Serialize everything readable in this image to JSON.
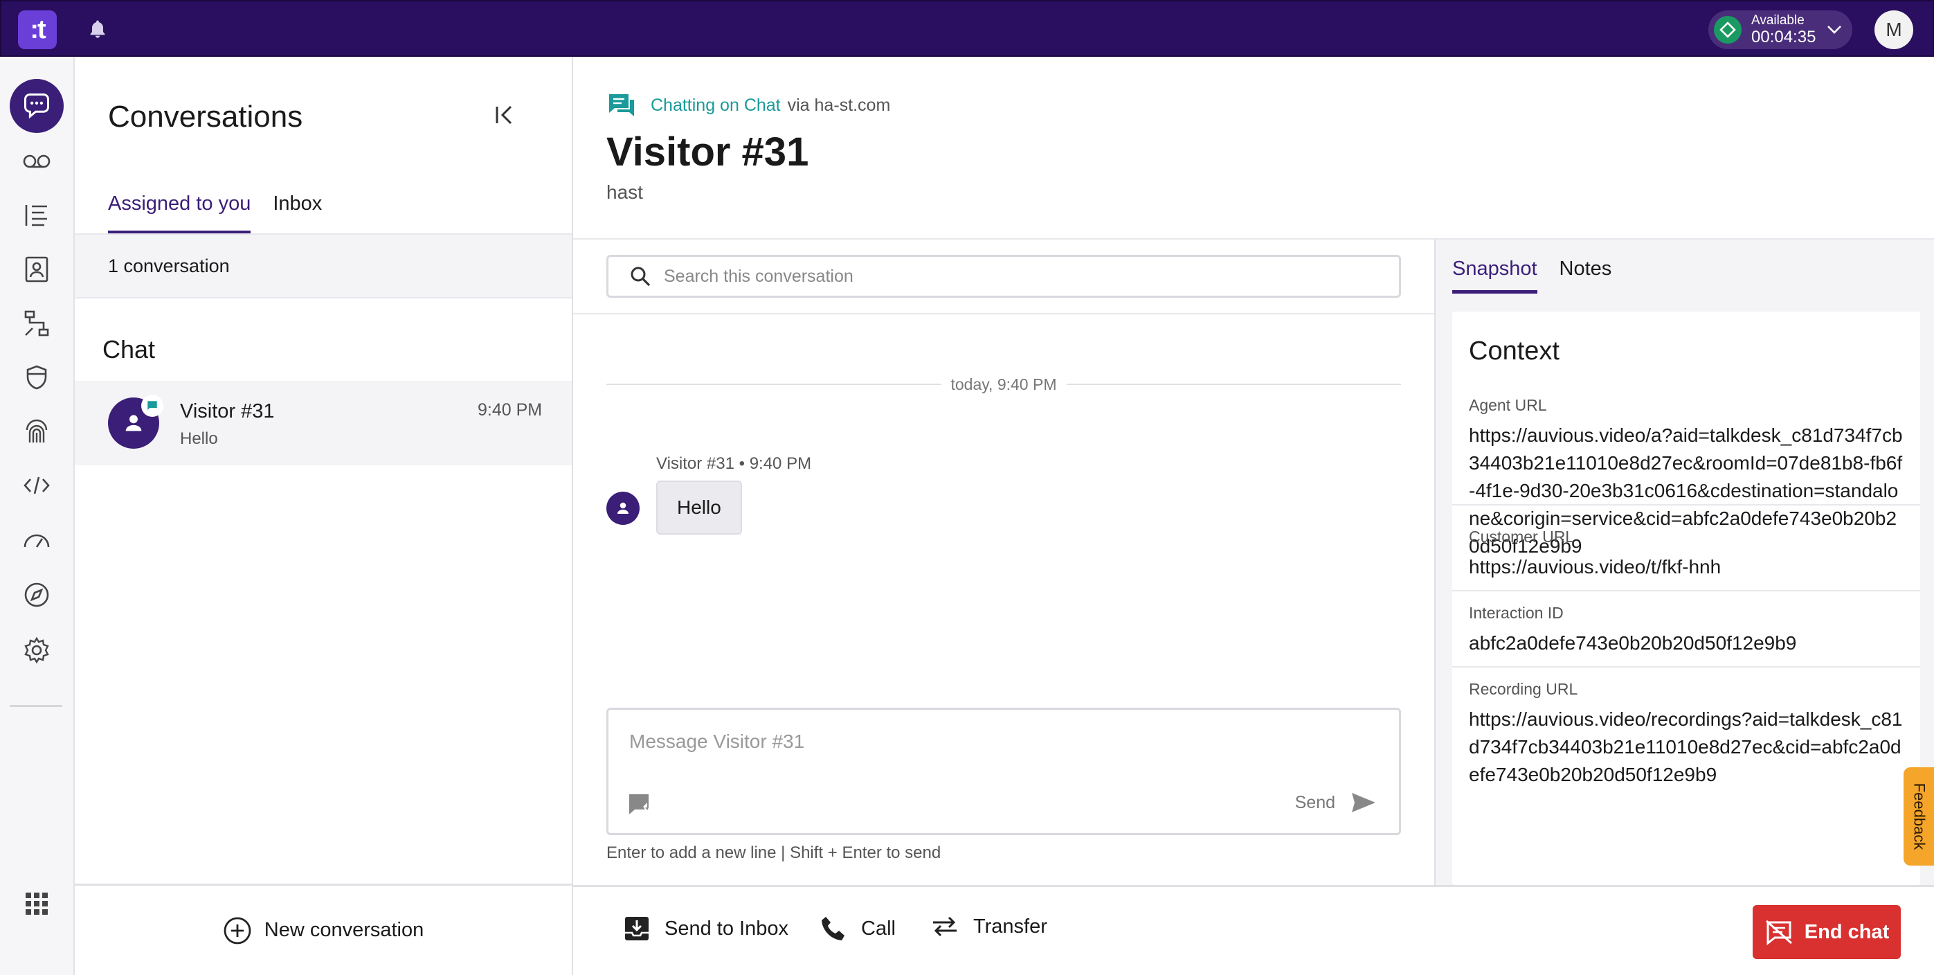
{
  "topbar": {
    "logo_text": ":t",
    "status_label": "Available",
    "status_timer": "00:04:35",
    "avatar_initial": "M"
  },
  "rail": {
    "items": [
      "conversations-icon",
      "voicemail-icon",
      "list-icon",
      "contacts-icon",
      "flows-icon",
      "shield-icon",
      "fingerprint-icon",
      "code-icon",
      "dashboard-icon",
      "compass-icon",
      "settings-icon",
      "apps-icon"
    ]
  },
  "conversations": {
    "title": "Conversations",
    "tabs": [
      "Assigned to you",
      "Inbox"
    ],
    "count": "1 conversation",
    "group_title": "Chat",
    "items": [
      {
        "name": "Visitor #31",
        "preview": "Hello",
        "time": "9:40 PM"
      }
    ],
    "new_conversation_label": "New conversation"
  },
  "header": {
    "channel_name": "Chatting on Chat",
    "channel_via": "via ha-st.com",
    "visitor_title": "Visitor #31",
    "visitor_sub": "hast"
  },
  "chat": {
    "search_placeholder": "Search this conversation",
    "day_separator": "today, 9:40 PM",
    "messages": [
      {
        "meta": "Visitor #31 • 9:40 PM",
        "text": "Hello"
      }
    ],
    "composer_placeholder": "Message Visitor #31",
    "send_label": "Send",
    "composer_hint": "Enter to add a new line | Shift + Enter to send"
  },
  "context": {
    "tabs": [
      "Snapshot",
      "Notes"
    ],
    "title": "Context",
    "fields": [
      {
        "label": "Agent URL",
        "value": "https://auvious.video/a?aid=talkdesk_c81d734f7cb34403b21e11010e8d27ec&roomId=07de81b8-fb6f-4f1e-9d30-20e3b31c0616&cdestination=standalone&corigin=service&cid=abfc2a0defe743e0b20b20d50f12e9b9"
      },
      {
        "label": "Customer URL",
        "value": "https://auvious.video/t/fkf-hnh"
      },
      {
        "label": "Interaction ID",
        "value": "abfc2a0defe743e0b20b20d50f12e9b9"
      },
      {
        "label": "Recording URL",
        "value": "https://auvious.video/recordings?aid=talkdesk_c81d734f7cb34403b21e11010e8d27ec&cid=abfc2a0defe743e0b20b20d50f12e9b9"
      }
    ],
    "feedback_label": "Feedback"
  },
  "actions": {
    "send_to_inbox": "Send to Inbox",
    "call": "Call",
    "transfer": "Transfer",
    "end_chat": "End chat"
  },
  "colors": {
    "topbar": "#2a0e5f",
    "brand": "#3b1e78",
    "accent_teal": "#1a9a9a",
    "end_chat": "#d93030",
    "feedback": "#f4a52a"
  }
}
